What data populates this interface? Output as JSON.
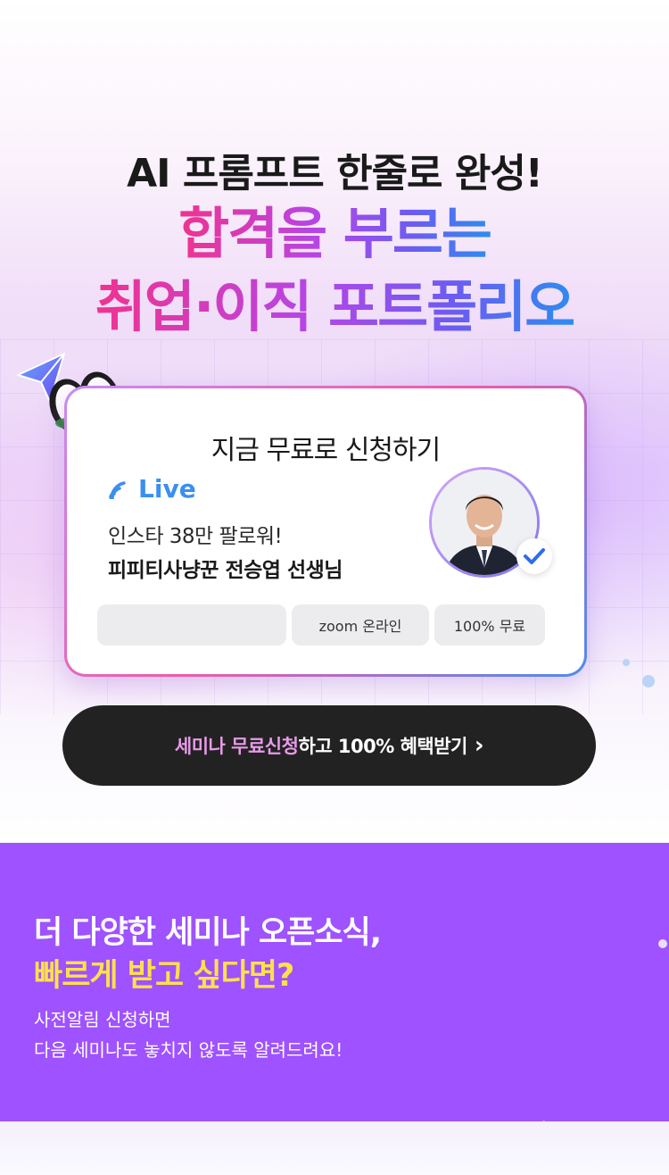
{
  "hero": {
    "headline_line1": "AI 프롬프트 한줄로 완성!",
    "headline_line2": "합격을 부르는",
    "headline_line3": "취업·이직 포트폴리오"
  },
  "card": {
    "title": "지금 무료로 신청하기",
    "live_label": "Live",
    "subtitle": "인스타 38만 팔로워!",
    "instructor": "피피티사냥꾼 전승엽 선생님",
    "pills": {
      "empty": "",
      "zoom": "zoom 온라인",
      "free": "100% 무료"
    }
  },
  "cta": {
    "highlight": "세미나 무료신청",
    "rest": "하고 100% 혜택받기",
    "arrow": "›"
  },
  "promo": {
    "line1": "더 다양한 세미나 오픈소식,",
    "line2": "빠르게 받고 싶다면?",
    "sub1": "사전알림 신청하면",
    "sub2": "다음 세미나도 놓치지 않도록 알려드려요!"
  },
  "colors": {
    "accent_purple": "#9f52ff",
    "accent_yellow": "#ffe04a",
    "live_blue": "#3a8ff0",
    "cta_bg": "#222222",
    "cta_highlight": "#e79ae8"
  },
  "icons": [
    "paper-plane-icon",
    "eyes-icon",
    "live-signal-icon",
    "verified-check-icon",
    "chevron-right-icon"
  ]
}
